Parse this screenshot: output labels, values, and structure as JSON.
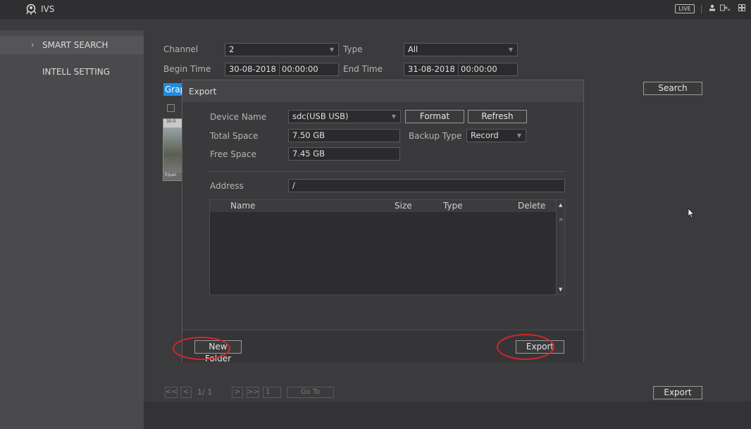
{
  "app": {
    "title": "IVS",
    "live_label": "LIVE"
  },
  "sidebar": {
    "items": [
      {
        "label": "SMART SEARCH",
        "chevron": "›"
      },
      {
        "label": "INTELL SETTING"
      }
    ]
  },
  "search": {
    "channel_label": "Channel",
    "channel_value": "2",
    "type_label": "Type",
    "type_value": "All",
    "begin_label": "Begin Time",
    "begin_date": "30-08-2018",
    "begin_time": "00:00:00",
    "end_label": "End Time",
    "end_date": "31-08-2018",
    "end_time": "00:00:00",
    "search_button": "Search",
    "tab_label": "Grap",
    "thumb_time": "30-0",
    "thumb_caption": "Tripwi"
  },
  "pagination": {
    "first": "<<",
    "prev": "<",
    "page_text": "1/ 1",
    "next": ">",
    "last": ">>",
    "page_input": "1",
    "goto": "Go To"
  },
  "footer": {
    "export_button": "Export"
  },
  "dialog": {
    "title": "Export",
    "device_name_label": "Device Name",
    "device_name_value": "sdc(USB USB)",
    "format_button": "Format",
    "refresh_button": "Refresh",
    "total_space_label": "Total Space",
    "total_space_value": "7.50 GB",
    "backup_type_label": "Backup Type",
    "backup_type_value": "Record",
    "free_space_label": "Free Space",
    "free_space_value": "7.45 GB",
    "address_label": "Address",
    "address_value": "/",
    "table_headers": {
      "name": "Name",
      "size": "Size",
      "type": "Type",
      "delete": "Delete"
    },
    "new_folder_button": "New Folder",
    "export_button": "Export"
  },
  "colors": {
    "accent": "#1f8ce0",
    "annotation": "#d6262a"
  }
}
